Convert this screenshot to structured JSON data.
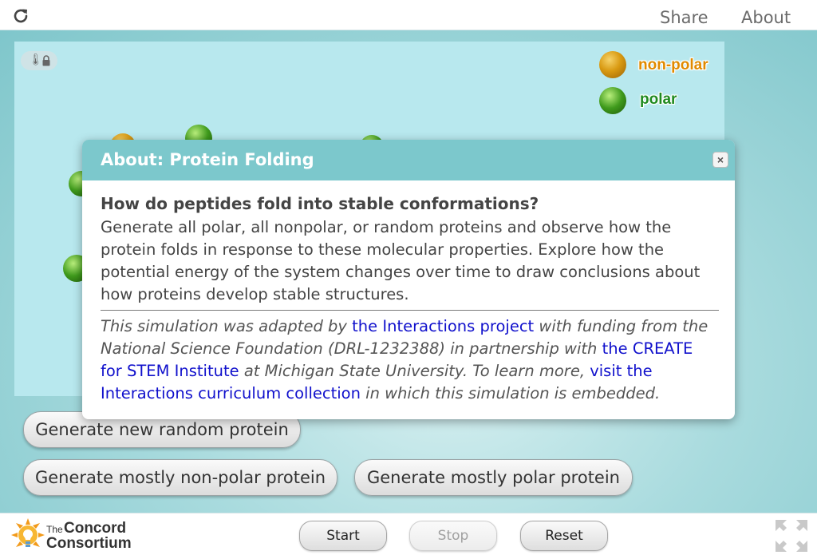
{
  "topbar": {
    "share": "Share",
    "about": "About"
  },
  "legend": [
    {
      "label": "non-polar",
      "color": "#e08a00"
    },
    {
      "label": "polar",
      "color": "#1f8a1f"
    }
  ],
  "buttons": {
    "random": "Generate new random protein",
    "nonpolar": "Generate mostly non-polar protein",
    "polar": "Generate mostly polar protein"
  },
  "controls": {
    "start": "Start",
    "stop": "Stop",
    "reset": "Reset"
  },
  "logo": {
    "the": "The",
    "concord": "Concord",
    "consortium": "Consortium"
  },
  "dialog": {
    "title": "About: Protein Folding",
    "close": "×",
    "question": "How do peptides fold into stable conformations?",
    "description": "Generate all polar, all nonpolar, or random proteins and observe how the protein folds in response to these molecular properties. Explore how the potential energy of the system changes over time to draw conclusions about how proteins develop stable structures.",
    "credit": {
      "t1": "This simulation was adapted by ",
      "link1": "the Interactions project",
      "t2": " with funding from the National Science Foundation (DRL-1232388) in partnership with ",
      "link2": "the CREATE for STEM Institute",
      "t3": " at Michigan State University. To learn more, ",
      "link3": "visit the Interactions curriculum collection",
      "t4": " in which this simulation is embedded."
    }
  }
}
